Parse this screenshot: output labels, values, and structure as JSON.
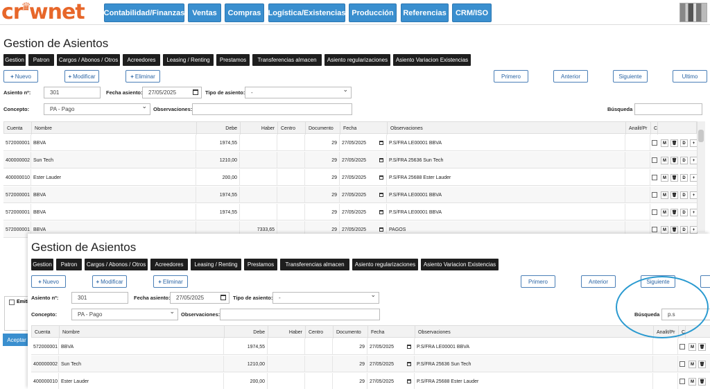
{
  "brand": {
    "logo_pre": "cr",
    "logo_post": "wnet",
    "logo_crown": "♛"
  },
  "nav": [
    "Contabilidad/Finanzas",
    "Ventas",
    "Compras",
    "Logística/Existencias",
    "Producción",
    "Referencias",
    "CRM/ISO"
  ],
  "title": "Gestion de Asientos",
  "tabs": [
    "Gestion",
    "Patron",
    "Cargos / Abonos / Otros",
    "Acreedores",
    "Leasing / Renting",
    "Prestamos",
    "Transferencias almacen",
    "Asiento regularizaciones",
    "Asiento Variacion Existencias"
  ],
  "actions": {
    "nuevo": "Nuevo",
    "modificar": "Modificar",
    "eliminar": "Eliminar",
    "primero": "Primero",
    "anterior": "Anterior",
    "siguiente": "Siguiente",
    "ultimo": "Ultimo"
  },
  "form": {
    "asiento_label": "Asiento nº:",
    "asiento_value": "301",
    "fecha_label": "Fecha asiento:",
    "fecha_value": "27/05/2025",
    "tipo_label": "Tipo de asiento:",
    "tipo_value": "-",
    "concepto_label": "Concepto:",
    "concepto_value": "PA - Pago",
    "obs_label": "Observaciones:",
    "obs_value": "",
    "busqueda_label": "Búsqueda",
    "busqueda_value": "",
    "busqueda_value_front": "p.s"
  },
  "columns": [
    "Cuenta",
    "Nombre",
    "Debe",
    "Haber",
    "Centro",
    "Documento",
    "Fecha",
    "Observaciones",
    "Analit/Pr",
    "C"
  ],
  "row_buttons": {
    "m": "M",
    "d": "D",
    "trash": "🗑",
    "plus": "+"
  },
  "rows": [
    {
      "cuenta": "572000001",
      "nombre": "BBVA",
      "debe": "1974,55",
      "haber": "",
      "documento": "29",
      "fecha": "27/05/2025",
      "obs": "P.S/FRA LE00001   BBVA"
    },
    {
      "cuenta": "400000002",
      "nombre": "Sun Tech",
      "debe": "1210,00",
      "haber": "",
      "documento": "29",
      "fecha": "27/05/2025",
      "obs": "P.S/FRA 25636   Sun Tech"
    },
    {
      "cuenta": "400000010",
      "nombre": "Ester Lauder",
      "debe": "200,00",
      "haber": "",
      "documento": "29",
      "fecha": "27/05/2025",
      "obs": "P.S/FRA 25688   Ester Lauder"
    },
    {
      "cuenta": "572000001",
      "nombre": "BBVA",
      "debe": "1974,55",
      "haber": "",
      "documento": "29",
      "fecha": "27/05/2025",
      "obs": "P.S/FRA LE00001   BBVA"
    },
    {
      "cuenta": "572000001",
      "nombre": "BBVA",
      "debe": "1974,55",
      "haber": "",
      "documento": "29",
      "fecha": "27/05/2025",
      "obs": "P.S/FRA LE00001   BBVA"
    },
    {
      "cuenta": "572000001",
      "nombre": "BBVA",
      "debe": "",
      "haber": "7333,65",
      "documento": "29",
      "fecha": "27/05/2025",
      "obs": "PAGOS"
    }
  ],
  "behind": {
    "emitir": "Emitir",
    "aceptar": "Aceptar"
  },
  "colors": {
    "nav": "#3a8fcf",
    "tab": "#1e1e1e",
    "logo": "#e7672a",
    "highlight": "#2a9ad0"
  }
}
